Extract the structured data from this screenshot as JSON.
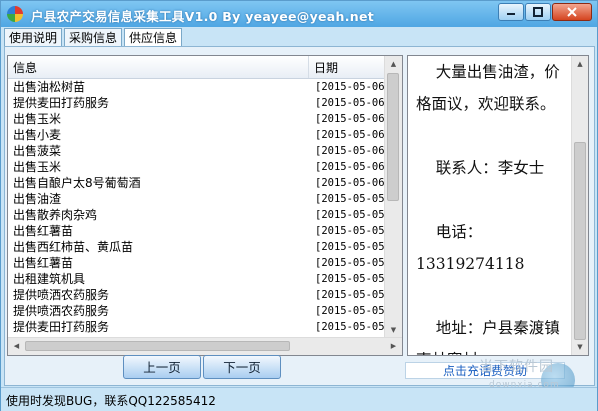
{
  "window": {
    "title": "户县农产交易信息采集工具V1.0  By yeayee@yeah.net"
  },
  "tabs": [
    {
      "label": "使用说明",
      "active": false
    },
    {
      "label": "采购信息",
      "active": false
    },
    {
      "label": "供应信息",
      "active": true
    }
  ],
  "list": {
    "columns": [
      "信息",
      "日期"
    ],
    "rows": [
      {
        "info": "出售油松树苗",
        "date": "[2015-05-06]"
      },
      {
        "info": "提供麦田打药服务",
        "date": "[2015-05-06]"
      },
      {
        "info": "出售玉米",
        "date": "[2015-05-06]"
      },
      {
        "info": "出售小麦",
        "date": "[2015-05-06]"
      },
      {
        "info": "出售菠菜",
        "date": "[2015-05-06]"
      },
      {
        "info": "出售玉米",
        "date": "[2015-05-06]"
      },
      {
        "info": "出售自酿户太8号葡萄酒",
        "date": "[2015-05-06]"
      },
      {
        "info": "出售油渣",
        "date": "[2015-05-05]"
      },
      {
        "info": "出售散养肉杂鸡",
        "date": "[2015-05-05]"
      },
      {
        "info": "出售红薯苗",
        "date": "[2015-05-05]"
      },
      {
        "info": "出售西红柿苗、黄瓜苗",
        "date": "[2015-05-05]"
      },
      {
        "info": "出售红薯苗",
        "date": "[2015-05-05]"
      },
      {
        "info": "出租建筑机具",
        "date": "[2015-05-05]"
      },
      {
        "info": "提供喷洒农药服务",
        "date": "[2015-05-05]"
      },
      {
        "info": "提供喷洒农药服务",
        "date": "[2015-05-05]"
      },
      {
        "info": "提供麦田打药服务",
        "date": "[2015-05-05]"
      }
    ]
  },
  "detail": {
    "text": "    大量出售油渣，价格面议，欢迎联系。\n\n    联系人：李女士\n\n    电话：\n13319274118\n\n    地址：户县秦渡镇枣林寨村"
  },
  "pager": {
    "prev": "上一页",
    "next": "下一页"
  },
  "donate_link": "点击充话费赞助",
  "watermark": {
    "text": "当下软件园",
    "sub": "downxia.com"
  },
  "status": "使用时发现BUG，联系QQ122585412"
}
